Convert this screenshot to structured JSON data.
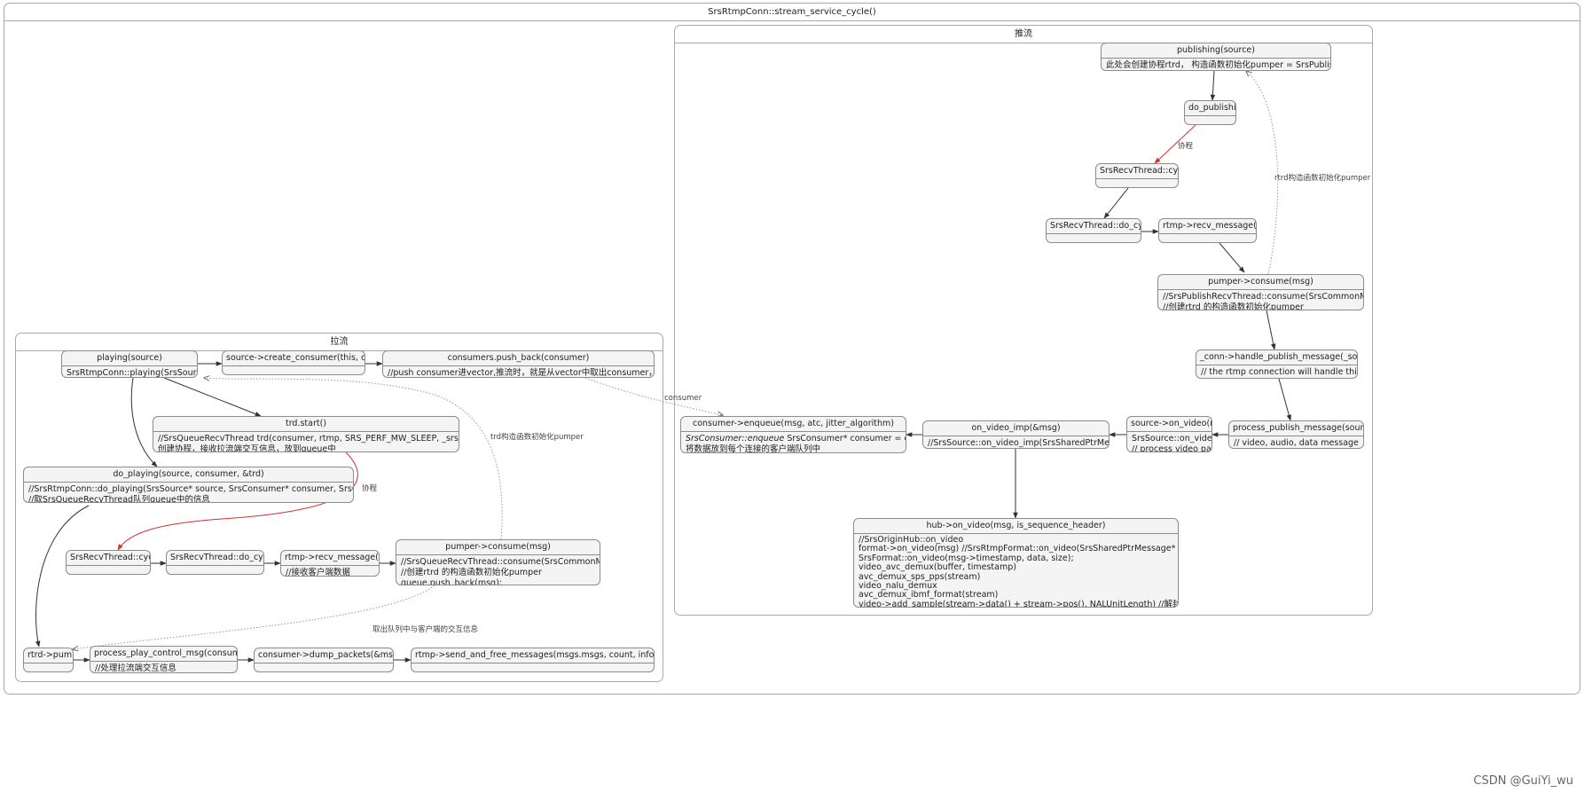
{
  "outer": {
    "title": "SrsRtmpConn::stream_service_cycle()"
  },
  "push": {
    "title": "推流",
    "publishing": {
      "title": "publishing(source)",
      "body": [
        "此处会创建协程rtrd， 构造函数初始化pumper = SrsPublishRecvThread"
      ]
    },
    "do_publishing": {
      "title": "do_publishing"
    },
    "recv_cycle": {
      "title": "SrsRecvThread::cycle()"
    },
    "recv_do_cycle": {
      "title": "SrsRecvThread::do_cycle()"
    },
    "recv_message": {
      "title": "rtmp->recv_message(&msg)"
    },
    "pumper_consume": {
      "title": "pumper->consume(msg)",
      "body": [
        "//SrsPublishRecvThread::consume(SrsCommonMessage* msg)",
        "//创建rtrd 的构造函数初始化pumper"
      ]
    },
    "handle_publish": {
      "title": "_conn->handle_publish_message(_source, msg)",
      "body": [
        "// the rtmp connection will handle this message"
      ]
    },
    "process_publish": {
      "title": "process_publish_message(source, msg)",
      "body": [
        "// video, audio, data message"
      ]
    },
    "source_on_video": {
      "title": "source->on_video(msg)",
      "body": [
        "SrsSource::on_video",
        "// process video packet"
      ]
    },
    "on_video_imp": {
      "title": "on_video_imp(&msg)",
      "body": [
        "//SrsSource::on_video_imp(SrsSharedPtrMessage* msg)"
      ]
    },
    "enqueue": {
      "title": "consumer->enqueue(msg, atc, jitter_algorithm)",
      "body_italic": "SrsConsumer::enqueue",
      "body_rest": " SrsConsumer* consumer = consumers.at(i)",
      "body2": "将数据放到每个连接的客户端队列中"
    },
    "hub_on_video": {
      "title": "hub->on_video(msg, is_sequence_header)",
      "body": [
        "//SrsOriginHub::on_video",
        "format->on_video(msg) //SrsRtmpFormat::on_video(SrsSharedPtrMessage* shared_video)",
        "SrsFormat::on_video(msg->timestamp, data, size);",
        "video_avc_demux(buffer, timestamp)",
        "avc_demux_sps_pps(stream)",
        "video_nalu_demux",
        "avc_demux_ibmf_format(stream)",
        "video->add_sample(stream->data() + stream->pos(), NALUnitLength) //解封装后数据放到add_sample"
      ]
    },
    "edge_coroutine": "协程",
    "edge_rtrd": "rtrd构造函数初始化pumper"
  },
  "pull": {
    "title": "拉流",
    "playing": {
      "title": "playing(source)",
      "body": [
        "SrsRtmpConn::playing(SrsSource* source)"
      ]
    },
    "create_consumer": {
      "title": "source->create_consumer(this, consumer)"
    },
    "push_back": {
      "title": "consumers.push_back(consumer)",
      "body": [
        "//push consumer进vector,推流时，就是从vector中取出consumer，将数据放到队列中"
      ]
    },
    "trd_start": {
      "title": "trd.start()",
      "body": [
        "//SrsQueueRecvThread trd(consumer, rtmp, SRS_PERF_MW_SLEEP, _srs_context->get_id());",
        "创建协程，接收拉流端交互信息，放到queue中"
      ]
    },
    "do_playing": {
      "title": "do_playing(source, consumer, &trd)",
      "body": [
        "//SrsRtmpConn::do_playing(SrsSource* source, SrsConsumer* consumer, SrsQueueRecvThread* rtrd)",
        "//取SrsQueueRecvThread队列queue中的信息"
      ]
    },
    "recv_cycle": {
      "title": "SrsRecvThread::cycle()"
    },
    "recv_do_cycle": {
      "title": "SrsRecvThread::do_cycle()"
    },
    "recv_message": {
      "title": "rtmp->recv_message(&msg)",
      "body": [
        "//接收客户端数据"
      ]
    },
    "pumper_consume": {
      "title": "pumper->consume(msg)",
      "body": [
        "//SrsQueueRecvThread::consume(SrsCommonMessage* msg)",
        "//创建rtrd 的构造函数初始化pumper",
        "queue.push_back(msg);"
      ]
    },
    "rtrd_pump": {
      "title": "rtrd->pump()"
    },
    "process_play_control": {
      "title": "process_play_control_msg(consumer, msg)",
      "body": [
        "//处理拉流端交互信息"
      ]
    },
    "dump_packets": {
      "title": "consumer->dump_packets(&msgs, count)"
    },
    "send_and_free": {
      "title": "rtmp->send_and_free_messages(msgs.msgs, count, info->res->stream_id)"
    },
    "edge_coroutine": "协程",
    "edge_trd": "trd构造函数初始化pumper",
    "edge_queue": "取出队列中与客户端的交互信息"
  },
  "edge_consumer": "consumer",
  "watermark": "CSDN @GuiYi_wu"
}
